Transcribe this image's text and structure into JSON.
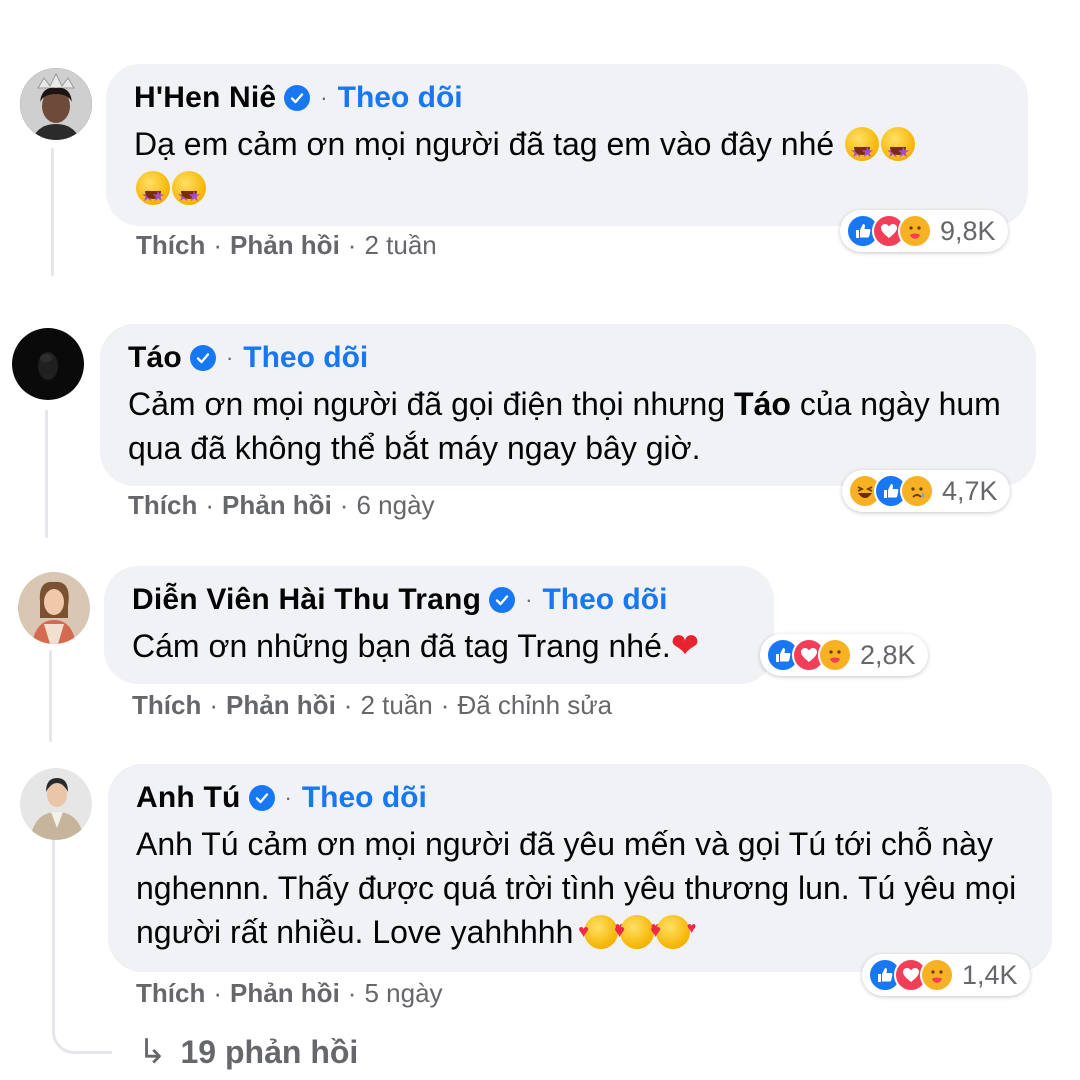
{
  "comments": [
    {
      "name": "H'Hen Niê",
      "follow": "Theo dõi",
      "text": "Dạ em cảm ơn mọi người đã tag em vào đây nhé",
      "like": "Thích",
      "reply": "Phản hồi",
      "time": "2 tuần",
      "reaction_count": "9,8K",
      "reaction_icons": [
        "like-icon",
        "love-icon",
        "care-icon"
      ]
    },
    {
      "name": "Táo",
      "follow": "Theo dõi",
      "text_before": "Cảm ơn mọi người đã gọi điện thọi nhưng ",
      "text_bold": "Táo",
      "text_after": " của ngày hum qua đã không thể bắt máy ngay bây giờ.",
      "like": "Thích",
      "reply": "Phản hồi",
      "time": "6 ngày",
      "reaction_count": "4,7K",
      "reaction_icons": [
        "haha-icon",
        "like-icon",
        "sad-icon"
      ]
    },
    {
      "name": "Diễn Viên Hài Thu Trang",
      "follow": "Theo dõi",
      "text": "Cám ơn những bạn đã tag Trang nhé.",
      "like": "Thích",
      "reply": "Phản hồi",
      "time": "2 tuần",
      "edited": "Đã chỉnh sửa",
      "reaction_count": "2,8K",
      "reaction_icons": [
        "like-icon",
        "love-icon",
        "care-icon"
      ]
    },
    {
      "name": "Anh Tú",
      "follow": "Theo dõi",
      "text": "Anh Tú cảm ơn mọi người đã yêu mến và gọi Tú tới chỗ này nghennn. Thấy được quá trời tình yêu thương lun. Tú yêu mọi người rất nhiều. Love yahhhhh",
      "like": "Thích",
      "reply": "Phản hồi",
      "time": "5 ngày",
      "reaction_count": "1,4K",
      "reaction_icons": [
        "like-icon",
        "love-icon",
        "care-icon"
      ]
    }
  ],
  "replies_label": "19 phản hồi",
  "colors": {
    "link": "#1877f2",
    "bubble": "#f0f2f5",
    "meta": "#65676b"
  }
}
